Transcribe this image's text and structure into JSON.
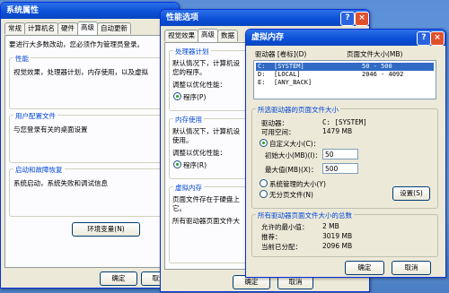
{
  "sys": {
    "title": "系统属性",
    "tabs": [
      "常规",
      "计算机名",
      "硬件",
      "高级",
      "自动更新"
    ],
    "intro": "要进行大多数改动，您必须作为管理员登录。",
    "perf_title": "性能",
    "perf_text": "视觉效果，处理器计划，内存使用，以及虚拟",
    "profile_title": "用户配置文件",
    "profile_text": "与您登录有关的桌面设置",
    "startup_title": "启动和故障恢复",
    "startup_text": "系统启动，系统失败和调试信息",
    "env_btn": "环境变量(N)",
    "ok": "确定",
    "cancel": "取消"
  },
  "perf": {
    "title": "性能选项",
    "tabs": [
      "视觉效果",
      "高级",
      "数据"
    ],
    "cpu_title": "处理器计划",
    "cpu_l1": "默认情况下，计算机设",
    "cpu_l2": "您的程序。",
    "adjust": "调整以优化性能：",
    "program": "程序(P)",
    "mem_title": "内存使用",
    "mem_l1": "默认情况下，计算机设",
    "mem_l2": "使用。",
    "adjust2": "调整以优化性能：",
    "program2": "程序(R)",
    "vm_title": "虚拟内存",
    "vm_l1": "页面文件存在于硬盘上",
    "vm_l2": "它。",
    "vm_total": "所有驱动器页面文件大",
    "ok": "确定",
    "cancel": "取消"
  },
  "vm": {
    "title": "虚拟内存",
    "col_drive": "驱动器 [卷标](D)",
    "col_size": "页面文件大小(MB)",
    "rows": [
      {
        "drive": "C:",
        "label": "[SYSTEM]",
        "size": "50 - 500"
      },
      {
        "drive": "D:",
        "label": "[LOCAL]",
        "size": "2046 - 4092"
      },
      {
        "drive": "E:",
        "label": "[ANY_BACK]",
        "size": ""
      }
    ],
    "sel_title": "所选驱动器的页面文件大小",
    "drive_lbl": "驱动器：",
    "drive_val": "C: [SYSTEM]",
    "space_lbl": "可用空间：",
    "space_val": "1479 MB",
    "custom": "自定义大小(C)：",
    "init_lbl": "初始大小(MB)(I)：",
    "init_val": "50",
    "max_lbl": "最大值(MB)(X)：",
    "max_val": "500",
    "managed": "系统管理的大小(Y)",
    "none": "无分页文件(N)",
    "set_btn": "设置(S)",
    "total_title": "所有驱动器页面文件大小的总数",
    "min_lbl": "允许的最小值：",
    "min_val": "2 MB",
    "rec_lbl": "推荐：",
    "rec_val": "3019 MB",
    "cur_lbl": "当前已分配：",
    "cur_val": "2096 MB",
    "ok": "确定",
    "cancel": "取消"
  }
}
